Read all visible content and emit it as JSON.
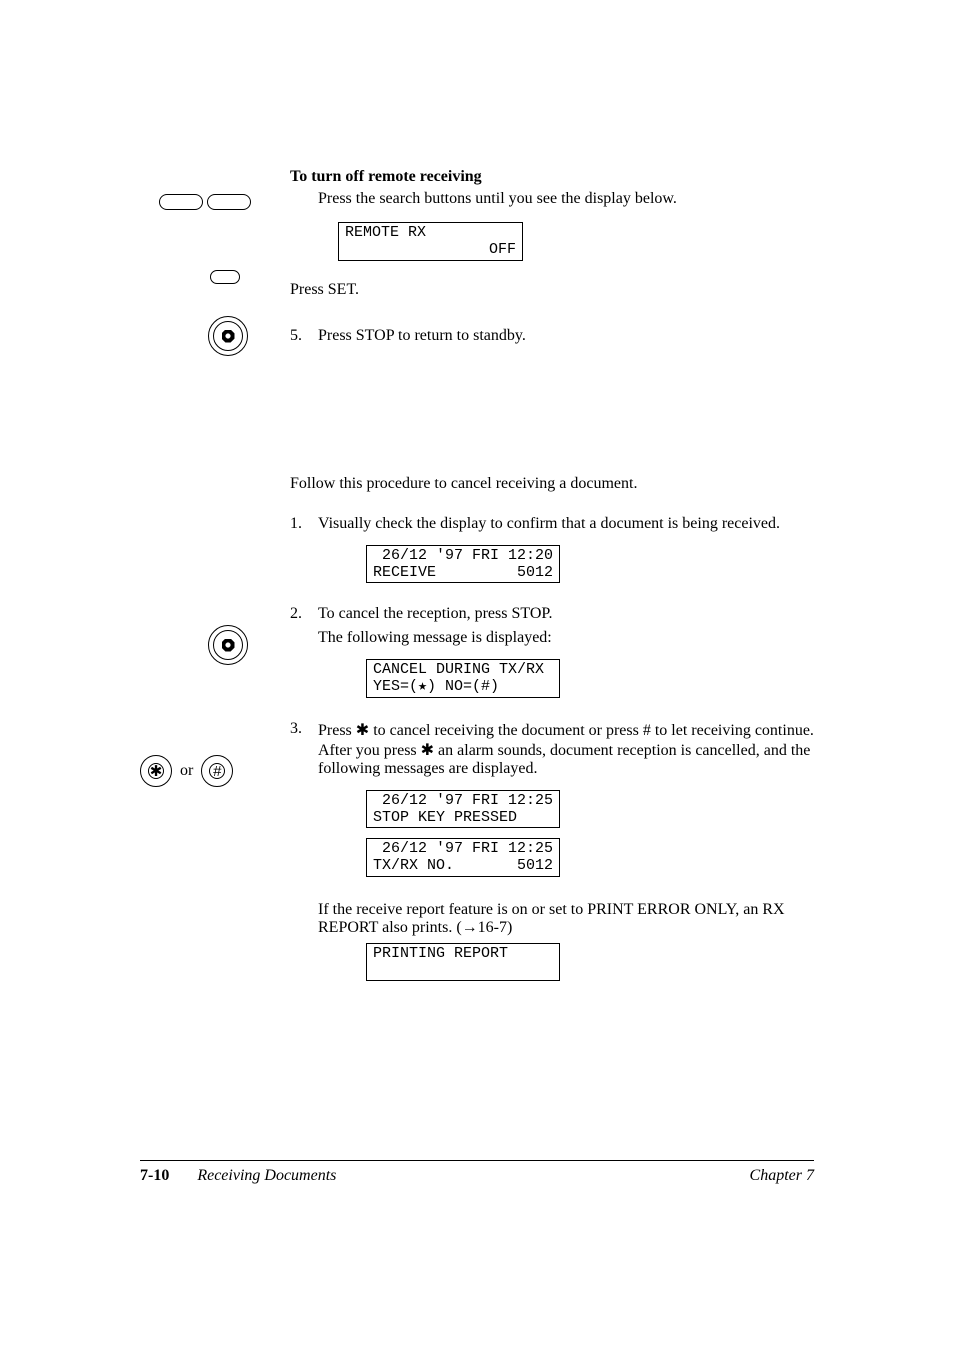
{
  "s1": {
    "heading": "To turn off remote receiving",
    "line1": "Press the search buttons until you see the display below.",
    "lcd1_l1": "REMOTE RX          ",
    "lcd1_l2": "                OFF",
    "line2": "Press SET.",
    "step5_num": "5.",
    "step5_text": "Press STOP to return to standby."
  },
  "s2": {
    "intro": "Follow this procedure to cancel receiving a document.",
    "step1_num": "1.",
    "step1_text": "Visually check the display to confirm that a document is being received.",
    "lcd2_l1": " 26/12 '97 FRI 12:20",
    "lcd2_l2": "RECEIVE         5012",
    "step2_num": "2.",
    "step2_text": "To cancel the reception, press STOP.",
    "step2_sub": "The following message is displayed:",
    "lcd3_l1": "CANCEL DURING TX/RX ",
    "lcd3_l2": "YES=(★) NO=(#)      ",
    "step3_num": "3.",
    "step3_text": "Press ✱ to cancel receiving the document or press # to let receiving continue. After you press ✱ an alarm sounds, document reception is cancelled, and the following messages are displayed.",
    "lcd4_l1": " 26/12 '97 FRI 12:25",
    "lcd4_l2": "STOP KEY PRESSED    ",
    "lcd5_l1": " 26/12 '97 FRI 12:25",
    "lcd5_l2": "TX/RX NO.       5012",
    "note": "If the receive report feature is on or set to PRINT ERROR ONLY, an RX REPORT also prints. (→16-7)",
    "lcd6_l1": "PRINTING REPORT     ",
    "lcd6_l2": "                    "
  },
  "footer": {
    "pagenum": "7-10",
    "title": "Receiving Documents",
    "chapter": "Chapter 7"
  },
  "icons": {
    "or": "or",
    "star": "✱",
    "hash": "#"
  }
}
